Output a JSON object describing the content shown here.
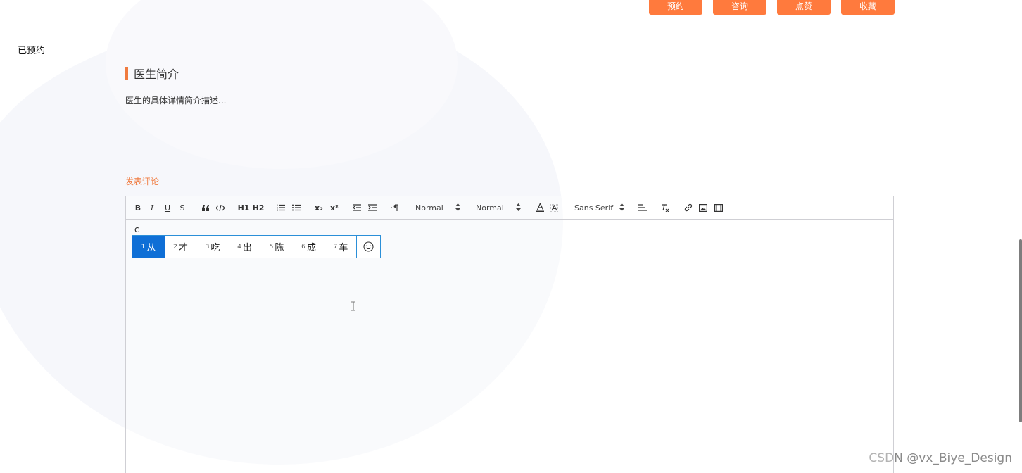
{
  "top_buttons": [
    "预约",
    "咨询",
    "点赞",
    "收藏"
  ],
  "side_label": "已预约",
  "section": {
    "title": "医生简介",
    "intro": "医生的具体详情简介描述..."
  },
  "comment": {
    "title": "发表评论"
  },
  "editor": {
    "toolbar": {
      "bold": "B",
      "italic": "I",
      "underline": "U",
      "strike": "S",
      "h1": "H1",
      "h2": "H2",
      "sub": "x₂",
      "sup": "x²",
      "size_select": "Normal",
      "header_select": "Normal",
      "font_select": "Sans Serif"
    },
    "typed_text": "c"
  },
  "ime": {
    "candidates": [
      {
        "num": "1",
        "text": "从"
      },
      {
        "num": "2",
        "text": "才"
      },
      {
        "num": "3",
        "text": "吃"
      },
      {
        "num": "4",
        "text": "出"
      },
      {
        "num": "5",
        "text": "陈"
      },
      {
        "num": "6",
        "text": "成"
      },
      {
        "num": "7",
        "text": "车"
      }
    ],
    "selected_index": 0
  },
  "colors": {
    "accent": "#ff7a3d",
    "ime_border": "#2b8fd8",
    "ime_selected": "#0f6fd6"
  },
  "watermark": "CSDN @vx_Biye_Design"
}
